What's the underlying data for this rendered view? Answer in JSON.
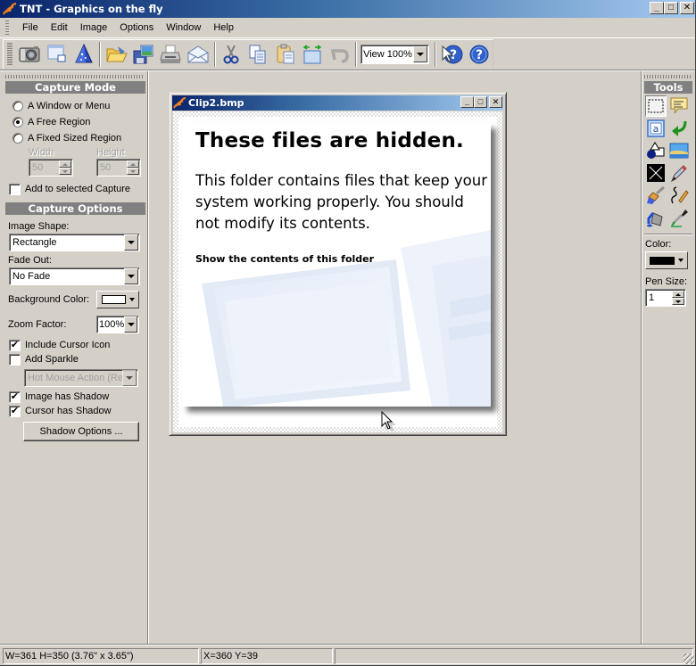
{
  "window": {
    "title": "TNT - Graphics on the fly",
    "minimize": "_",
    "maximize": "□",
    "close": "✕"
  },
  "menu": [
    "File",
    "Edit",
    "Image",
    "Options",
    "Window",
    "Help"
  ],
  "toolbar": {
    "buttons": [
      {
        "name": "camera-capture",
        "icon": "camera-icon"
      },
      {
        "name": "window-capture",
        "icon": "window-icon"
      },
      {
        "name": "wizard",
        "icon": "wizard-hat-icon"
      },
      {
        "name": "open",
        "icon": "folder-open-icon"
      },
      {
        "name": "save",
        "icon": "floppy-save-icon"
      },
      {
        "name": "print",
        "icon": "printer-icon"
      },
      {
        "name": "email",
        "icon": "envelope-icon"
      },
      {
        "name": "cut",
        "icon": "scissors-icon"
      },
      {
        "name": "copy",
        "icon": "copy-icon"
      },
      {
        "name": "paste",
        "icon": "paste-icon"
      },
      {
        "name": "resize",
        "icon": "resize-icon"
      },
      {
        "name": "undo",
        "icon": "undo-icon"
      },
      {
        "name": "context-help",
        "icon": "context-help-icon"
      },
      {
        "name": "help",
        "icon": "help-icon"
      }
    ],
    "view_select": "View 100%"
  },
  "left_panel": {
    "capture_mode": {
      "header": "Capture Mode",
      "options": [
        {
          "label": "A Window or Menu",
          "selected": false
        },
        {
          "label": "A Free Region",
          "selected": true
        },
        {
          "label": "A Fixed Sized Region",
          "selected": false
        }
      ],
      "width_label": "Width",
      "height_label": "Height",
      "width_value": "50",
      "height_value": "50",
      "add_to_selected": {
        "label": "Add to selected Capture",
        "checked": false
      }
    },
    "capture_options": {
      "header": "Capture Options",
      "image_shape_label": "Image Shape:",
      "image_shape_value": "Rectangle",
      "fade_out_label": "Fade Out:",
      "fade_out_value": "No Fade",
      "background_color_label": "Background Color:",
      "background_color": "#ffffff",
      "zoom_factor_label": "Zoom Factor:",
      "zoom_factor_value": "100%",
      "include_cursor": {
        "label": "Include Cursor Icon",
        "checked": true,
        "mark": "✔"
      },
      "add_sparkle": {
        "label": "Add Sparkle",
        "checked": false,
        "mark": ""
      },
      "sparkle_select": "Hot Mouse Action (Red",
      "image_shadow": {
        "label": "Image has Shadow",
        "checked": true,
        "mark": "✔"
      },
      "cursor_shadow": {
        "label": "Cursor has Shadow",
        "checked": true,
        "mark": "✔"
      },
      "shadow_options_button": "Shadow Options ..."
    }
  },
  "child_window": {
    "title": "Clip2.bmp",
    "minimize": "_",
    "maximize": "□",
    "close": "✕",
    "content": {
      "heading": "These files are hidden.",
      "body": "This folder contains files that keep your system working properly. You should not modify its contents.",
      "link": "Show the contents of this folder"
    }
  },
  "right_panel": {
    "header": "Tools",
    "tools": [
      {
        "name": "select-rect",
        "icon": "marquee-select-icon",
        "active": true
      },
      {
        "name": "callout",
        "icon": "callout-icon",
        "active": false
      },
      {
        "name": "text",
        "icon": "text-tool-icon",
        "active": false
      },
      {
        "name": "arrow",
        "icon": "arrow-tool-icon",
        "active": false
      },
      {
        "name": "shapes",
        "icon": "shapes-icon",
        "active": false
      },
      {
        "name": "image",
        "icon": "picture-icon",
        "active": false
      },
      {
        "name": "crop-x",
        "icon": "cross-box-icon",
        "active": false
      },
      {
        "name": "pencil",
        "icon": "pencil-icon",
        "active": false
      },
      {
        "name": "brush",
        "icon": "paintbrush-icon",
        "active": false
      },
      {
        "name": "freehand",
        "icon": "freehand-pen-icon",
        "active": false
      },
      {
        "name": "fill",
        "icon": "paint-bucket-icon",
        "active": false
      },
      {
        "name": "eyedropper",
        "icon": "eyedropper-icon",
        "active": false
      }
    ],
    "color_label": "Color:",
    "color_value": "#000000",
    "pen_size_label": "Pen Size:",
    "pen_size_value": "1"
  },
  "status_bar": {
    "dimensions": "W=361  H=350  (3.76\" x 3.65\")",
    "coords": "X=360  Y=39",
    "extra": ""
  }
}
